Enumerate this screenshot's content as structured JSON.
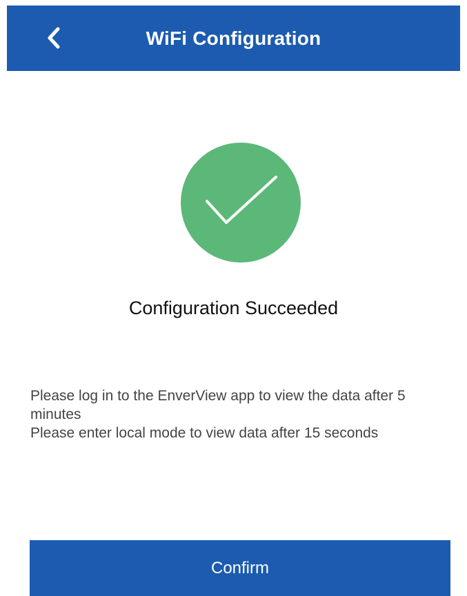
{
  "header": {
    "title": "WiFi Configuration",
    "back_icon": "chevron-left-icon"
  },
  "result": {
    "icon": "checkmark-circle-icon",
    "icon_color": "#5cb878",
    "title": "Configuration Succeeded",
    "message": "Please log in to the EnverView app to view the data after 5 minutes\n Please enter local mode to view data after 15 seconds"
  },
  "actions": {
    "confirm_label": "Confirm"
  },
  "colors": {
    "primary": "#1c5bb0",
    "success": "#5cb878"
  }
}
